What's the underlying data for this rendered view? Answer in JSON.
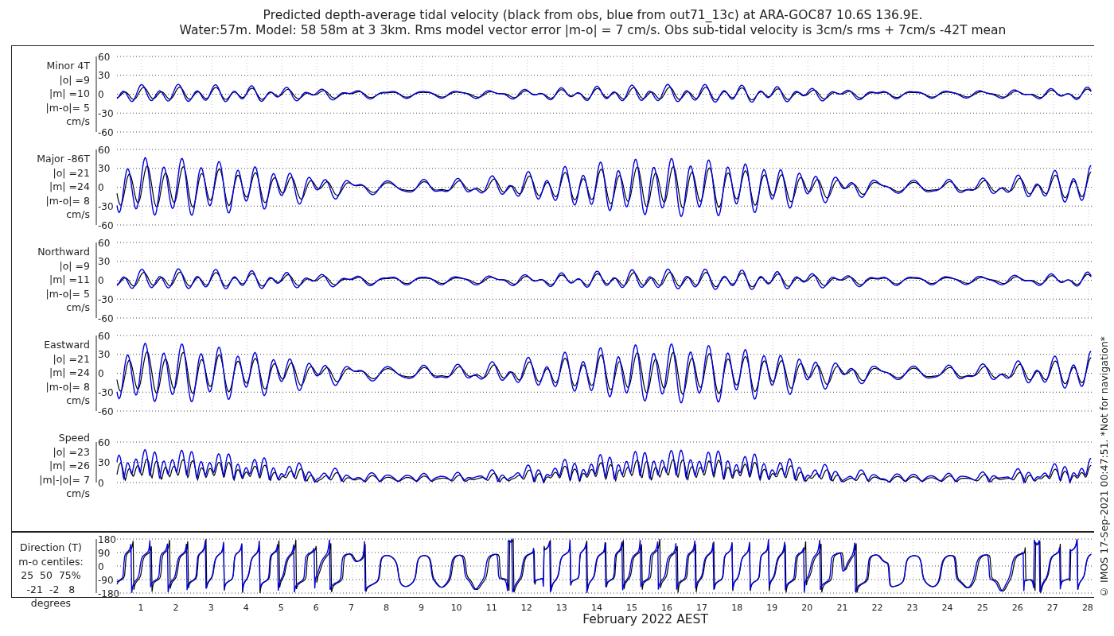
{
  "title_lines": [
    "Predicted depth-average tidal velocity (black from obs, blue from out71_13c) at ARA-GOC87 10.6S 136.9E.",
    "Water:57m. Model: 58 58m at 3 3km. Rms model vector error |m-o| = 7 cm/s. Obs sub-tidal velocity is 3cm/s rms + 7cm/s -42T mean"
  ],
  "panels": [
    {
      "kind": "velocity",
      "label_lines": [
        "Minor 4T",
        "|o| =9",
        "|m| =10",
        "|m-o|= 5",
        "cm/s"
      ],
      "yticks": [
        "60",
        "30",
        "0",
        "-30",
        "-60"
      ]
    },
    {
      "kind": "velocity",
      "label_lines": [
        "Major -86T",
        "|o| =21",
        "|m| =24",
        "|m-o|= 8",
        "cm/s"
      ],
      "yticks": [
        "60",
        "30",
        "0",
        "-30",
        "-60"
      ]
    },
    {
      "kind": "velocity",
      "label_lines": [
        "Northward",
        "|o| =9",
        "|m| =11",
        "|m-o|= 5",
        "cm/s"
      ],
      "yticks": [
        "60",
        "30",
        "0",
        "-30",
        "-60"
      ]
    },
    {
      "kind": "velocity",
      "label_lines": [
        "Eastward",
        "|o| =21",
        "|m| =24",
        "|m-o|= 8",
        "cm/s"
      ],
      "yticks": [
        "60",
        "30",
        "0",
        "-30",
        "-60"
      ]
    },
    {
      "kind": "speed",
      "label_lines": [
        "Speed",
        "|o| =23",
        "|m| =26",
        "|m|-|o|= 7",
        "cm/s"
      ],
      "yticks": [
        "60",
        "30",
        "0"
      ]
    },
    {
      "kind": "direction",
      "label_lines": [
        "Direction (T)",
        "m-o centiles:",
        "25  50  75%",
        "-21  -2   8",
        "degrees"
      ],
      "yticks": [
        "180",
        "90",
        "0",
        "-90",
        "-180"
      ]
    }
  ],
  "x_ticks": [
    "1",
    "2",
    "3",
    "4",
    "5",
    "6",
    "7",
    "8",
    "9",
    "10",
    "11",
    "12",
    "13",
    "14",
    "15",
    "16",
    "17",
    "18",
    "19",
    "20",
    "21",
    "22",
    "23",
    "24",
    "25",
    "26",
    "27",
    "28"
  ],
  "x_label": "February 2022 AEST",
  "credit": "© IMOS 17-Sep-2021 00:47:51. *Not for navigation*"
}
